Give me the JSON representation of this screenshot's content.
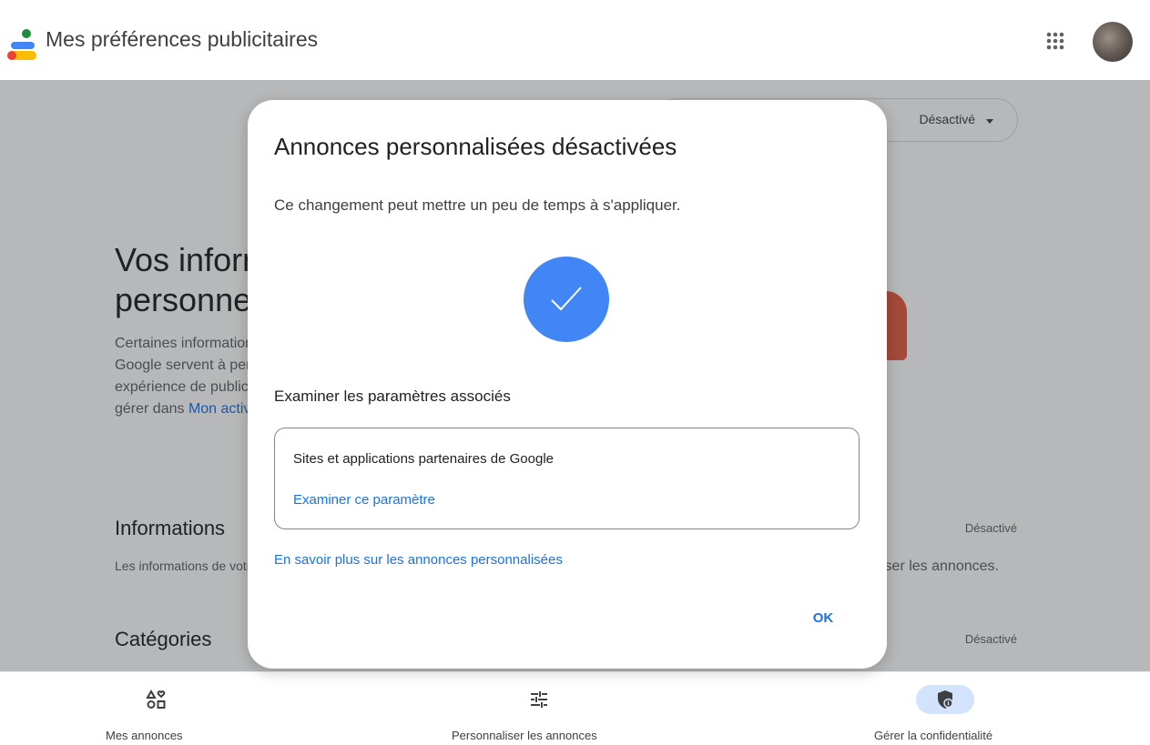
{
  "header": {
    "title": "Mes préférences publicitaires",
    "apps_icon": "apps-grid-icon",
    "avatar_icon": "avatar"
  },
  "background": {
    "status_pill_label": "Désactivé",
    "hero_title": "Vos informations personnelles",
    "hero_text_before_link": "Certaines informations de votre compte Google servent à personnaliser votre expérience de publicité. Vous pouvez les gérer dans ",
    "hero_link": "Mon activité",
    "section1_title": "Informations",
    "section1_desc": "Les informations de votre compte",
    "section1_desc_right": "iser les annonces.",
    "section1_status": "Désactivé",
    "section2_title": "Catégories",
    "section2_status": "Désactivé"
  },
  "dialog": {
    "title": "Annonces personnalisées désactivées",
    "subtitle": "Ce changement peut mettre un peu de temps à s'appliquer.",
    "check_icon": "check-icon",
    "related_title": "Examiner les paramètres associés",
    "setting_name": "Sites et applications partenaires de Google",
    "setting_link": "Examiner ce paramètre",
    "learn_more": "En savoir plus sur les annonces personnalisées",
    "ok_label": "OK"
  },
  "bottom_nav": {
    "items": [
      {
        "label": "Mes annonces",
        "icon": "ads-shapes-icon",
        "active": false
      },
      {
        "label": "Personnaliser les annonces",
        "icon": "tune-icon",
        "active": false
      },
      {
        "label": "Gérer la confidentialité",
        "icon": "privacy-shield-icon",
        "active": true
      }
    ]
  },
  "colors": {
    "accent": "#1a73e8",
    "check_circle": "#4285f4",
    "active_nav": "#d3e3fd"
  }
}
